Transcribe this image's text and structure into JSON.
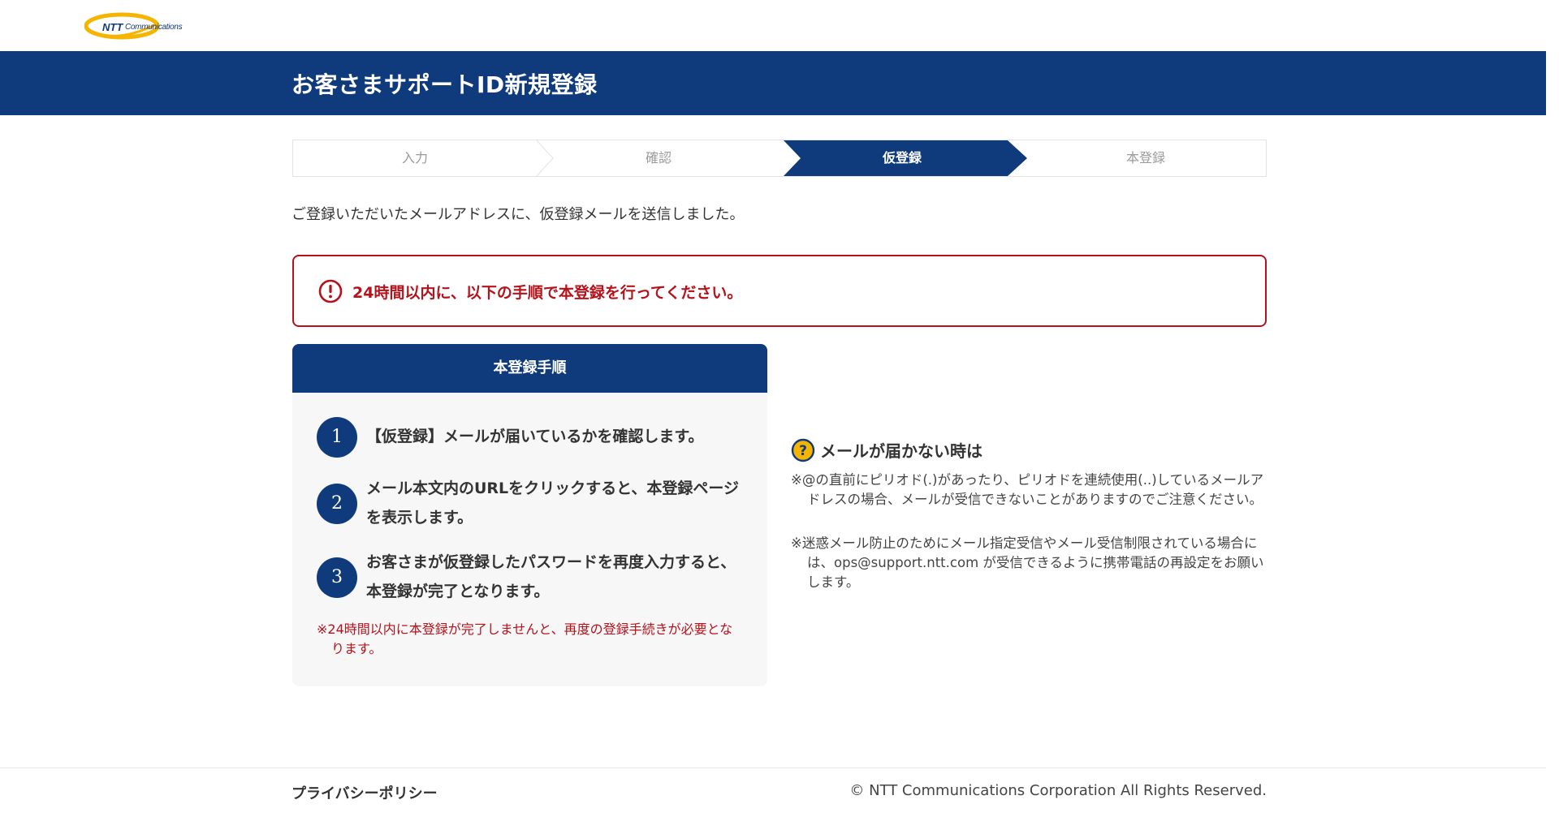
{
  "brand": {
    "logo_ntt": "NTT",
    "logo_comm": "Communications",
    "logo_color": "#123a7a",
    "accent_yellow": "#f5b400"
  },
  "header": {
    "title": "お客さまサポートID新規登録",
    "band_color": "#0f3a7c"
  },
  "stepper": {
    "steps": [
      {
        "label": "入力",
        "state": "inactive"
      },
      {
        "label": "確認",
        "state": "inactive"
      },
      {
        "label": "仮登録",
        "state": "active"
      },
      {
        "label": "本登録",
        "state": "inactive"
      }
    ],
    "active_color": "#0f3a7c"
  },
  "intro": {
    "text": "ご登録いただいたメールアドレスに、仮登録メールを送信しました。"
  },
  "alert": {
    "icon": "exclamation-circle-icon",
    "text": "24時間以内に、以下の手順で本登録を行ってください。",
    "color": "#b5121b"
  },
  "steps_panel": {
    "title": "本登録手順",
    "items": [
      {
        "num": "1",
        "text": "【仮登録】メールが届いているかを確認します。"
      },
      {
        "num": "2",
        "text": "メール本文内のURLをクリックすると、本登録ページを表示します。"
      },
      {
        "num": "3",
        "text": "お客さまが仮登録したパスワードを再度入力すると、本登録が完了となります。"
      }
    ],
    "note": "※24時間以内に本登録が完了しませんと、再度の登録手続きが必要となります。"
  },
  "help": {
    "icon": "question-circle-icon",
    "title": "メールが届かない時は",
    "notes": [
      "※@の直前にピリオド(.)があったり、ピリオドを連続使用(..)しているメールアドレスの場合、メールが受信できないことがありますのでご注意ください。",
      "※迷惑メール防止のためにメール指定受信やメール受信制限されている場合には、ops@support.ntt.com が受信できるように携帯電話の再設定をお願いします。"
    ]
  },
  "footer": {
    "privacy_label": "プライバシーポリシー",
    "copyright": "© NTT Communications Corporation All Rights Reserved."
  }
}
